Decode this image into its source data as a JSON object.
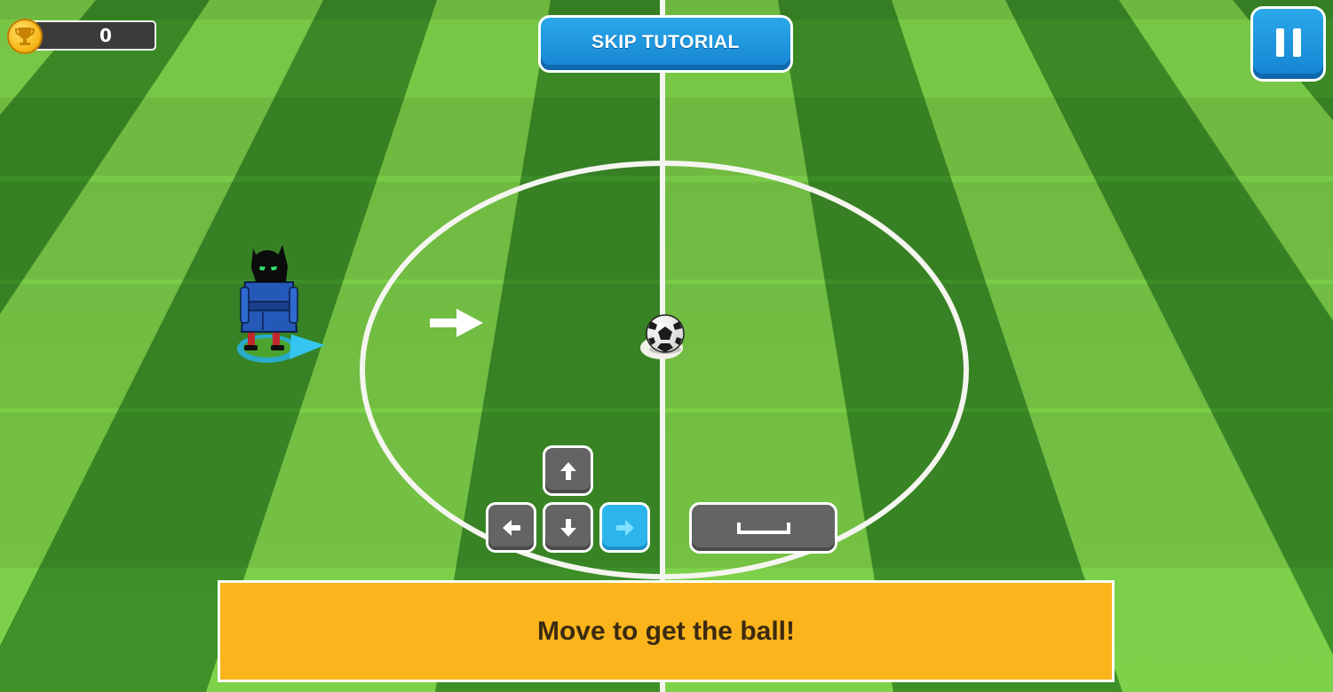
{
  "hud": {
    "score": "0",
    "score_icon": "trophy-coin-icon",
    "skip_label": "SKIP TUTORIAL",
    "pause_icon": "pause-icon"
  },
  "controls": {
    "keys": [
      "up-arrow-key",
      "left-arrow-key",
      "down-arrow-key",
      "right-arrow-key",
      "space-key"
    ],
    "active_key": "right-arrow-key"
  },
  "tutorial": {
    "instruction": "Move to get the ball!"
  },
  "colors": {
    "grass_light": "#7ed24a",
    "grass_dark": "#3e9128",
    "button_blue": "#1d93dd",
    "key_gray": "#646464",
    "key_active": "#2cb4ec",
    "panel_yellow": "#fbb41c",
    "player_blue": "#2459b8"
  }
}
